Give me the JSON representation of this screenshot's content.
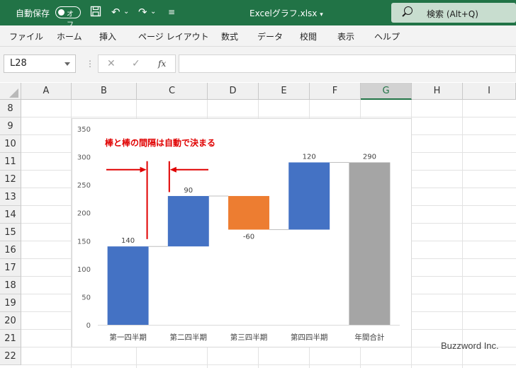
{
  "titlebar": {
    "autosave_label": "自動保存",
    "autosave_state": "オフ",
    "doc_title": "Excelグラフ.xlsx",
    "search_text": "検索 (Alt+Q)"
  },
  "menu": [
    "ファイル",
    "ホーム",
    "挿入",
    "ページ レイアウト",
    "数式",
    "データ",
    "校閲",
    "表示",
    "ヘルプ"
  ],
  "namebox": "L28",
  "formula": "",
  "columns": [
    "A",
    "B",
    "C",
    "D",
    "E",
    "F",
    "G",
    "H",
    "I"
  ],
  "selected_column": "G",
  "rows": [
    "8",
    "9",
    "10",
    "11",
    "12",
    "13",
    "14",
    "15",
    "16",
    "17",
    "18",
    "19",
    "20",
    "21",
    "22"
  ],
  "annotation": "棒と棒の間隔は自動で決まる",
  "watermark": "Buzzword Inc.",
  "colors": {
    "excel_green": "#217346",
    "increase": "#4472c4",
    "decrease": "#ed7d31",
    "total": "#a5a5a5",
    "annotation": "#e00000"
  },
  "chart_data": {
    "type": "bar",
    "subtype": "waterfall",
    "categories": [
      "第一四半期",
      "第二四半期",
      "第三四半期",
      "第四四半期",
      "年間合計"
    ],
    "values": [
      140,
      90,
      -60,
      120,
      290
    ],
    "data_labels": [
      "140",
      "90",
      "-60",
      "120",
      "290"
    ],
    "kinds": [
      "increase",
      "increase",
      "decrease",
      "increase",
      "total"
    ],
    "ylim": [
      0,
      350
    ],
    "yticks": [
      "0",
      "50",
      "100",
      "150",
      "200",
      "250",
      "300",
      "350"
    ],
    "title": "",
    "xlabel": "",
    "ylabel": "",
    "grid": false,
    "legend": "none"
  }
}
